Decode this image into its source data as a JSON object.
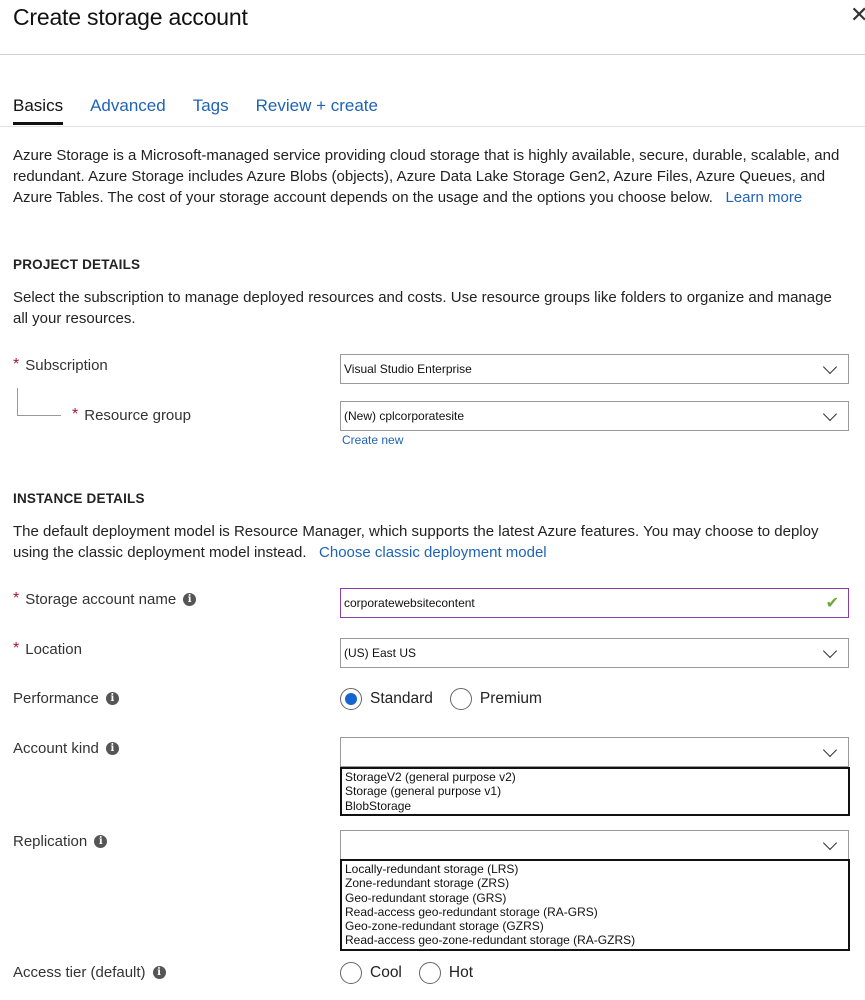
{
  "header": {
    "title": "Create storage account",
    "close_icon": "close-icon"
  },
  "tabs": [
    {
      "label": "Basics",
      "active": true
    },
    {
      "label": "Advanced",
      "active": false
    },
    {
      "label": "Tags",
      "active": false
    },
    {
      "label": "Review + create",
      "active": false
    }
  ],
  "intro": {
    "text": "Azure Storage is a Microsoft-managed service providing cloud storage that is highly available, secure, durable, scalable, and redundant. Azure Storage includes Azure Blobs (objects), Azure Data Lake Storage Gen2, Azure Files, Azure Queues, and Azure Tables. The cost of your storage account depends on the usage and the options you choose below.",
    "link": "Learn more"
  },
  "project": {
    "heading": "PROJECT DETAILS",
    "description": "Select the subscription to manage deployed resources and costs. Use resource groups like folders to organize and manage all your resources.",
    "subscription": {
      "label": "Subscription",
      "required": true,
      "value": "Visual Studio Enterprise"
    },
    "resource_group": {
      "label": "Resource group",
      "required": true,
      "value": "(New) cplcorporatesite",
      "create_new": "Create new"
    }
  },
  "instance": {
    "heading": "INSTANCE DETAILS",
    "description": "The default deployment model is Resource Manager, which supports the latest Azure features. You may choose to deploy using the classic deployment model instead.",
    "classic_link": "Choose classic deployment model",
    "storage_account_name": {
      "label": "Storage account name",
      "required": true,
      "value": "corporatewebsitecontent",
      "valid": true
    },
    "location": {
      "label": "Location",
      "required": true,
      "value": "(US) East US"
    },
    "performance": {
      "label": "Performance",
      "options": [
        "Standard",
        "Premium"
      ],
      "selected": "Standard"
    },
    "account_kind": {
      "label": "Account kind",
      "value": "",
      "options": [
        "StorageV2 (general purpose v2)",
        "Storage (general purpose v1)",
        "BlobStorage"
      ]
    },
    "replication": {
      "label": "Replication",
      "value": "",
      "options": [
        "Locally-redundant storage (LRS)",
        "Zone-redundant storage (ZRS)",
        "Geo-redundant storage (GRS)",
        "Read-access geo-redundant storage (RA-GRS)",
        "Geo-zone-redundant storage (GZRS)",
        "Read-access geo-zone-redundant storage (RA-GZRS)"
      ]
    },
    "access_tier": {
      "label": "Access tier (default)",
      "options": [
        "Cool",
        "Hot"
      ],
      "selected": null
    }
  },
  "colors": {
    "link": "#1f63b5",
    "required": "#b0112f",
    "radio_selected": "#1565d0",
    "valid_border": "#8a3ea8",
    "valid_check": "#6cab33"
  }
}
